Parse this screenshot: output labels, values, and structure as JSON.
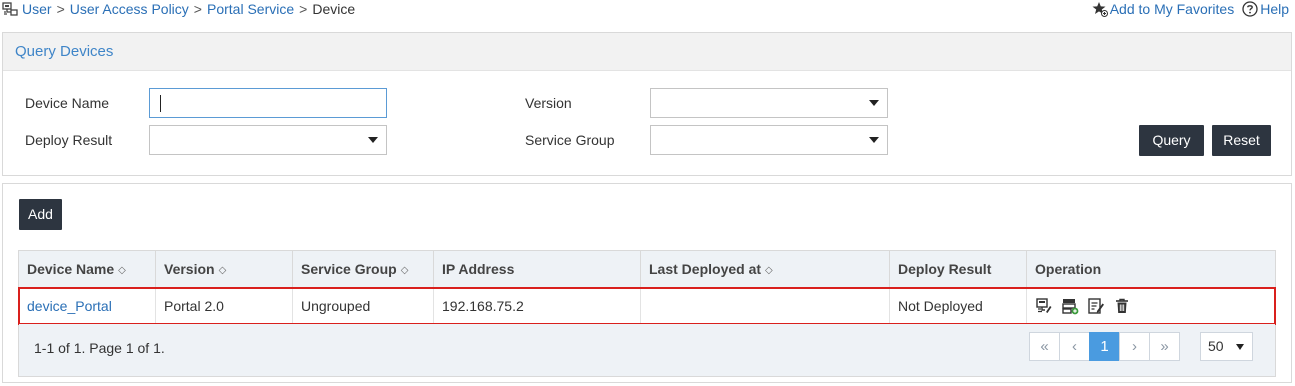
{
  "breadcrumb": {
    "items": [
      "User",
      "User Access Policy",
      "Portal Service"
    ],
    "current": "Device",
    "separator": ">"
  },
  "top_links": {
    "favorites": "Add to My Favorites",
    "help": "Help"
  },
  "query": {
    "title": "Query Devices",
    "device_name_label": "Device Name",
    "device_name_value": "",
    "version_label": "Version",
    "version_value": "",
    "deploy_result_label": "Deploy Result",
    "deploy_result_value": "",
    "service_group_label": "Service Group",
    "service_group_value": "",
    "query_button": "Query",
    "reset_button": "Reset"
  },
  "list": {
    "add_button": "Add",
    "columns": [
      {
        "label": "Device Name",
        "sortable": true
      },
      {
        "label": "Version",
        "sortable": true
      },
      {
        "label": "Service Group",
        "sortable": true
      },
      {
        "label": "IP Address",
        "sortable": false
      },
      {
        "label": "Last Deployed at",
        "sortable": true
      },
      {
        "label": "Deploy Result",
        "sortable": false
      },
      {
        "label": "Operation",
        "sortable": false
      }
    ],
    "rows": [
      {
        "device_name": "device_Portal",
        "version": "Portal 2.0",
        "service_group": "Ungrouped",
        "ip_address": "192.168.75.2",
        "last_deployed_at": "",
        "deploy_result": "Not Deployed",
        "operations": [
          "device-details-icon",
          "deploy-icon",
          "modify-icon",
          "delete-icon"
        ]
      }
    ],
    "summary": "1-1 of 1. Page 1 of 1.",
    "pager": {
      "first": "«",
      "prev": "‹",
      "current_page": "1",
      "next": "›",
      "last": "»"
    },
    "page_size": "50"
  },
  "colors": {
    "accent": "#3f85c8",
    "dark_button": "#2d3540",
    "highlight_border": "#d9201d",
    "active_page": "#4a9be0"
  }
}
